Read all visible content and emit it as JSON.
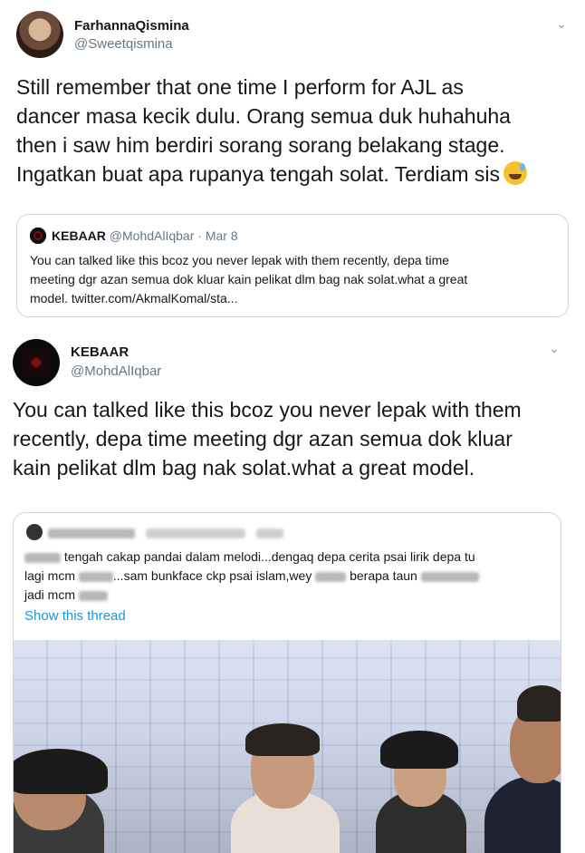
{
  "tweet1": {
    "name": "FarhannaQismina",
    "handle": "@Sweetqismina",
    "text_lines": [
      "Still remember that one time I perform for AJL as",
      "dancer masa kecik dulu. Orang semua duk huhahuha",
      "then i saw him berdiri sorang sorang belakang stage.",
      "Ingatkan buat apa rupanya tengah solat. Terdiam sis"
    ],
    "emoji": "sweat-smile-emoji",
    "quote": {
      "name": "KEBAAR",
      "handle": "@MohdAlIqbar",
      "date": "Mar 8",
      "text_lines": [
        "You can talked like this bcoz you never lepak with them recently, depa time",
        "meeting dgr azan semua dok kluar kain pelikat dlm bag nak solat.what a great",
        "model. twitter.com/AkmalKomal/sta..."
      ]
    }
  },
  "tweet2": {
    "name": "KEBAAR",
    "handle": "@MohdAlIqbar",
    "text_lines": [
      "You can talked like this bcoz you never lepak with them",
      "recently, depa time meeting dgr azan semua dok kluar",
      "kain pelikat dlm bag nak solat.what a great model."
    ],
    "quote": {
      "line1_visible": "tengah cakap pandai dalam melodi...dengaq depa cerita psai lirik depa tu",
      "line2_a": "lagi mcm",
      "line2_b": "...sam bunkface ckp psai islam,wey",
      "line2_c": "berapa taun",
      "line3": "jadi mcm",
      "show_thread": "Show this thread"
    }
  },
  "colors": {
    "link": "#1b95e0",
    "muted": "#657786",
    "border": "#ccd6dd"
  }
}
